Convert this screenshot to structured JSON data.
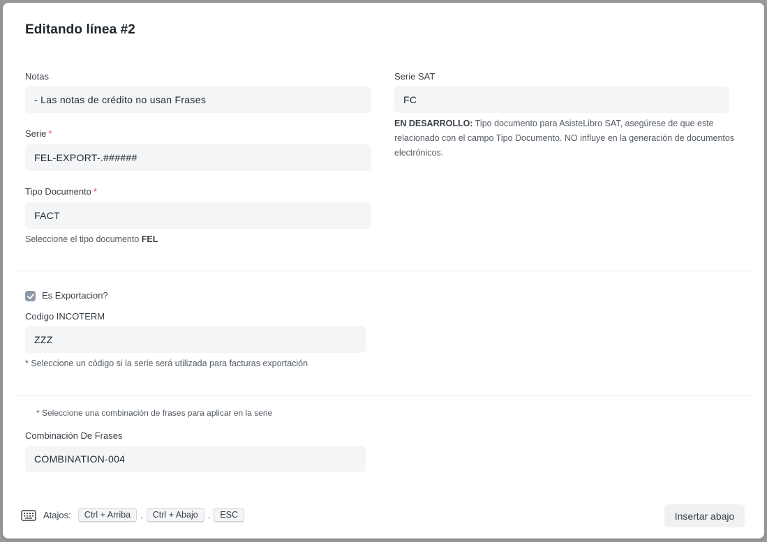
{
  "modal": {
    "title": "Editando línea #2"
  },
  "left": {
    "notas": {
      "label": "Notas",
      "value": "- Las notas de crédito no usan Frases"
    },
    "serie": {
      "label": "Serie",
      "required": "*",
      "value": "FEL-EXPORT-.######"
    },
    "tipo_documento": {
      "label": "Tipo Documento",
      "required": "*",
      "value": "FACT",
      "help_prefix": "Seleccione el tipo documento ",
      "help_bold": "FEL"
    }
  },
  "right": {
    "serie_sat": {
      "label": "Serie SAT",
      "value": "FC",
      "help_bold": "EN DESARROLLO:",
      "help_text": " Tipo documento para AsisteLibro SAT, asegúrese de que este relacionado con el campo Tipo Documento. NO influye en la generación de documentos electrónicos."
    }
  },
  "export_section": {
    "checkbox_label": "Es Exportacion?",
    "checked": true,
    "incoterm": {
      "label": "Codigo INCOTERM",
      "value": "ZZZ",
      "help": "* Seleccione un código si la serie será utilizada para facturas exportación"
    }
  },
  "frases_section": {
    "note": "* Seleccione una combinación de frases para aplicar en la serie",
    "combinacion": {
      "label": "Combinación De Frases",
      "value": "COMBINATION-004"
    }
  },
  "footer": {
    "shortcuts_label": "Atajos:",
    "keys": [
      "Ctrl + Arriba",
      "Ctrl + Abajo",
      "ESC"
    ],
    "separator": ".",
    "insert_button": "Insertar abajo"
  }
}
